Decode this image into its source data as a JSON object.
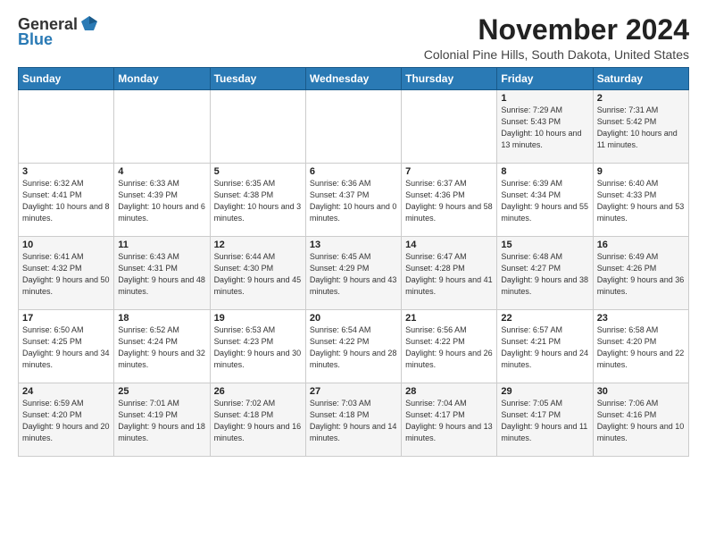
{
  "logo": {
    "general": "General",
    "blue": "Blue"
  },
  "header": {
    "month": "November 2024",
    "location": "Colonial Pine Hills, South Dakota, United States"
  },
  "days_of_week": [
    "Sunday",
    "Monday",
    "Tuesday",
    "Wednesday",
    "Thursday",
    "Friday",
    "Saturday"
  ],
  "weeks": [
    [
      {
        "day": "",
        "info": ""
      },
      {
        "day": "",
        "info": ""
      },
      {
        "day": "",
        "info": ""
      },
      {
        "day": "",
        "info": ""
      },
      {
        "day": "",
        "info": ""
      },
      {
        "day": "1",
        "info": "Sunrise: 7:29 AM\nSunset: 5:43 PM\nDaylight: 10 hours and 13 minutes."
      },
      {
        "day": "2",
        "info": "Sunrise: 7:31 AM\nSunset: 5:42 PM\nDaylight: 10 hours and 11 minutes."
      }
    ],
    [
      {
        "day": "3",
        "info": "Sunrise: 6:32 AM\nSunset: 4:41 PM\nDaylight: 10 hours and 8 minutes."
      },
      {
        "day": "4",
        "info": "Sunrise: 6:33 AM\nSunset: 4:39 PM\nDaylight: 10 hours and 6 minutes."
      },
      {
        "day": "5",
        "info": "Sunrise: 6:35 AM\nSunset: 4:38 PM\nDaylight: 10 hours and 3 minutes."
      },
      {
        "day": "6",
        "info": "Sunrise: 6:36 AM\nSunset: 4:37 PM\nDaylight: 10 hours and 0 minutes."
      },
      {
        "day": "7",
        "info": "Sunrise: 6:37 AM\nSunset: 4:36 PM\nDaylight: 9 hours and 58 minutes."
      },
      {
        "day": "8",
        "info": "Sunrise: 6:39 AM\nSunset: 4:34 PM\nDaylight: 9 hours and 55 minutes."
      },
      {
        "day": "9",
        "info": "Sunrise: 6:40 AM\nSunset: 4:33 PM\nDaylight: 9 hours and 53 minutes."
      }
    ],
    [
      {
        "day": "10",
        "info": "Sunrise: 6:41 AM\nSunset: 4:32 PM\nDaylight: 9 hours and 50 minutes."
      },
      {
        "day": "11",
        "info": "Sunrise: 6:43 AM\nSunset: 4:31 PM\nDaylight: 9 hours and 48 minutes."
      },
      {
        "day": "12",
        "info": "Sunrise: 6:44 AM\nSunset: 4:30 PM\nDaylight: 9 hours and 45 minutes."
      },
      {
        "day": "13",
        "info": "Sunrise: 6:45 AM\nSunset: 4:29 PM\nDaylight: 9 hours and 43 minutes."
      },
      {
        "day": "14",
        "info": "Sunrise: 6:47 AM\nSunset: 4:28 PM\nDaylight: 9 hours and 41 minutes."
      },
      {
        "day": "15",
        "info": "Sunrise: 6:48 AM\nSunset: 4:27 PM\nDaylight: 9 hours and 38 minutes."
      },
      {
        "day": "16",
        "info": "Sunrise: 6:49 AM\nSunset: 4:26 PM\nDaylight: 9 hours and 36 minutes."
      }
    ],
    [
      {
        "day": "17",
        "info": "Sunrise: 6:50 AM\nSunset: 4:25 PM\nDaylight: 9 hours and 34 minutes."
      },
      {
        "day": "18",
        "info": "Sunrise: 6:52 AM\nSunset: 4:24 PM\nDaylight: 9 hours and 32 minutes."
      },
      {
        "day": "19",
        "info": "Sunrise: 6:53 AM\nSunset: 4:23 PM\nDaylight: 9 hours and 30 minutes."
      },
      {
        "day": "20",
        "info": "Sunrise: 6:54 AM\nSunset: 4:22 PM\nDaylight: 9 hours and 28 minutes."
      },
      {
        "day": "21",
        "info": "Sunrise: 6:56 AM\nSunset: 4:22 PM\nDaylight: 9 hours and 26 minutes."
      },
      {
        "day": "22",
        "info": "Sunrise: 6:57 AM\nSunset: 4:21 PM\nDaylight: 9 hours and 24 minutes."
      },
      {
        "day": "23",
        "info": "Sunrise: 6:58 AM\nSunset: 4:20 PM\nDaylight: 9 hours and 22 minutes."
      }
    ],
    [
      {
        "day": "24",
        "info": "Sunrise: 6:59 AM\nSunset: 4:20 PM\nDaylight: 9 hours and 20 minutes."
      },
      {
        "day": "25",
        "info": "Sunrise: 7:01 AM\nSunset: 4:19 PM\nDaylight: 9 hours and 18 minutes."
      },
      {
        "day": "26",
        "info": "Sunrise: 7:02 AM\nSunset: 4:18 PM\nDaylight: 9 hours and 16 minutes."
      },
      {
        "day": "27",
        "info": "Sunrise: 7:03 AM\nSunset: 4:18 PM\nDaylight: 9 hours and 14 minutes."
      },
      {
        "day": "28",
        "info": "Sunrise: 7:04 AM\nSunset: 4:17 PM\nDaylight: 9 hours and 13 minutes."
      },
      {
        "day": "29",
        "info": "Sunrise: 7:05 AM\nSunset: 4:17 PM\nDaylight: 9 hours and 11 minutes."
      },
      {
        "day": "30",
        "info": "Sunrise: 7:06 AM\nSunset: 4:16 PM\nDaylight: 9 hours and 10 minutes."
      }
    ]
  ]
}
